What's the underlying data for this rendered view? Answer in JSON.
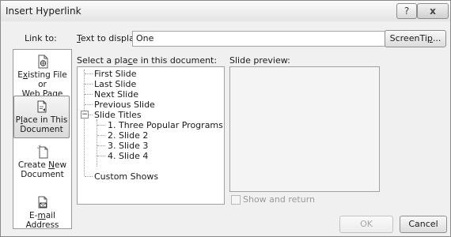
{
  "window": {
    "title": "Insert Hyperlink",
    "help_glyph": "?",
    "close_glyph": "x"
  },
  "link_to": {
    "label": "Link to:"
  },
  "text_display": {
    "label_pre": "",
    "label_ul": "T",
    "label_post": "ext to display:",
    "value": "One"
  },
  "screentip": {
    "label_pre": "ScreenTi",
    "label_ul": "p",
    "label_post": "..."
  },
  "sidebar": {
    "items": [
      {
        "l1_pre": "E",
        "l1_ul": "x",
        "l1_post": "isting File or",
        "l2": "Web Page",
        "icon": "web-page-icon"
      },
      {
        "l1_pre": "P",
        "l1_ul": "l",
        "l1_post": "ace in This",
        "l2": "Document",
        "icon": "place-in-document-icon",
        "selected": true
      },
      {
        "l1": "Create ",
        "l1_ul2": "N",
        "l1_post2": "ew",
        "l2": "Document",
        "icon": "new-document-icon"
      },
      {
        "l1_pre": "E-",
        "l1_ul": "m",
        "l1_post": "ail Address",
        "icon": "email-address-icon"
      }
    ]
  },
  "place_list": {
    "label_pre": "Select a pla",
    "label_ul": "c",
    "label_post": "e in this document:",
    "items": [
      "First Slide",
      "Last Slide",
      "Next Slide",
      "Previous Slide",
      "Slide Titles",
      "1. Three Popular Programs",
      "2. Slide 2",
      "3. Slide 3",
      "4. Slide 4",
      "Custom Shows"
    ],
    "expander_glyph": "−"
  },
  "preview": {
    "label": "Slide preview:"
  },
  "show_return": {
    "label": "Show and return",
    "checked": false
  },
  "buttons": {
    "ok": "OK",
    "cancel": "Cancel"
  }
}
